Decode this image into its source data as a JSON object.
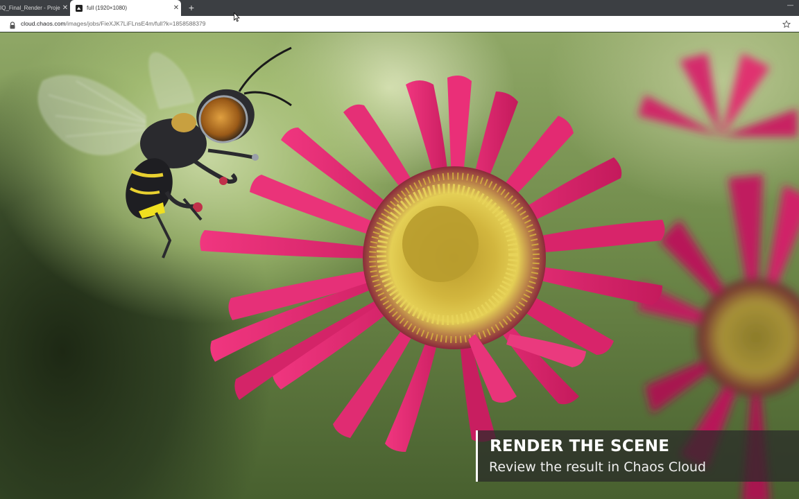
{
  "browser": {
    "tabs": [
      {
        "title": "IQ_Final_Render - Proje",
        "active": false
      },
      {
        "title": "full (1920×1080)",
        "active": true
      }
    ],
    "address": {
      "host": "cloud.chaos.com",
      "path": "/images/jobs/FieXJK7LiFLnsE4m/full?k=1858588379"
    }
  },
  "overlay": {
    "title": "RENDER THE SCENE",
    "subtitle": "Review the result in Chaos Cloud"
  },
  "icons": {
    "tab_close": "close-icon",
    "new_tab": "plus-icon",
    "lock": "lock-icon",
    "bookmark": "star-icon",
    "minimize": "minimize-icon"
  },
  "colors": {
    "tabbar": "#3c3f43",
    "petal": "#e0246f",
    "flower_center": "#c9b03a",
    "caption_bg": "#2a2c2a"
  }
}
